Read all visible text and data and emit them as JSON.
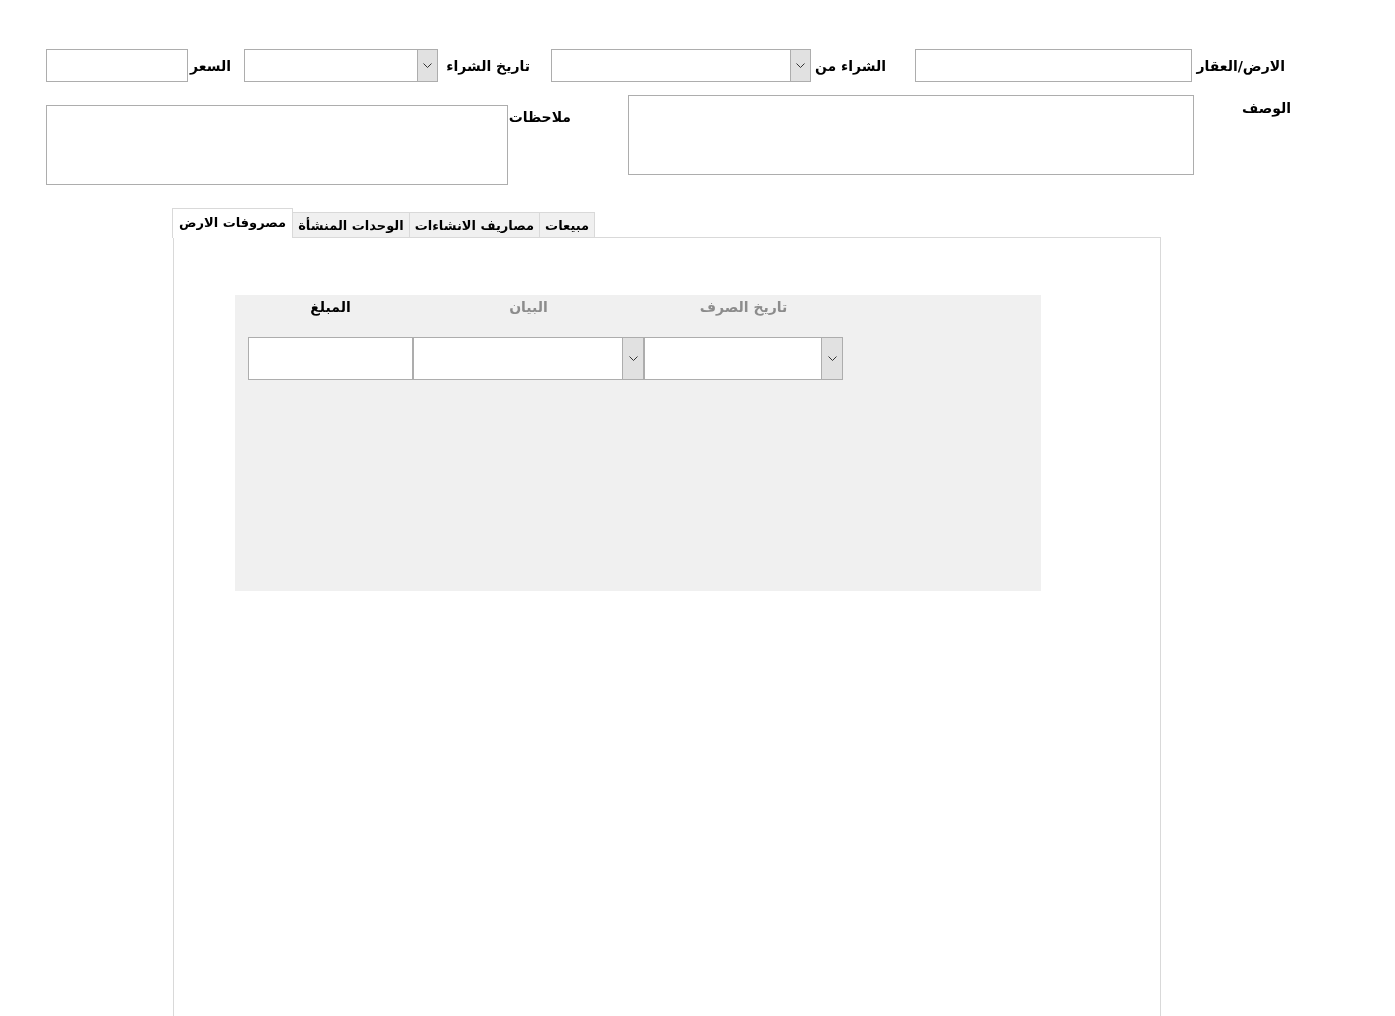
{
  "fields": [
    {
      "kind": "text",
      "label": "الارض/العقار"
    },
    {
      "kind": "combo",
      "label": "الشراء من"
    },
    {
      "kind": "combo",
      "label": "تاريخ الشراء"
    },
    {
      "kind": "text",
      "label": "السعر"
    }
  ],
  "memo_fields": [
    {
      "label": "الوصف"
    },
    {
      "label": "ملاحظات"
    }
  ],
  "tabs": [
    {
      "label": "مبيعات",
      "selected": false
    },
    {
      "label": "مصاريف الانشاءات",
      "selected": false
    },
    {
      "label": "الوحدات المنشأة",
      "selected": false
    },
    {
      "label": "مصروفات الارض",
      "selected": true
    }
  ],
  "expense_grid": {
    "columns": [
      {
        "label": "تاريخ الصرف",
        "disabled": true
      },
      {
        "label": "البيان",
        "disabled": true
      },
      {
        "label": "المبلغ",
        "disabled": false
      }
    ],
    "row": [
      {
        "kind": "combo"
      },
      {
        "kind": "combo"
      },
      {
        "kind": "text"
      }
    ]
  }
}
